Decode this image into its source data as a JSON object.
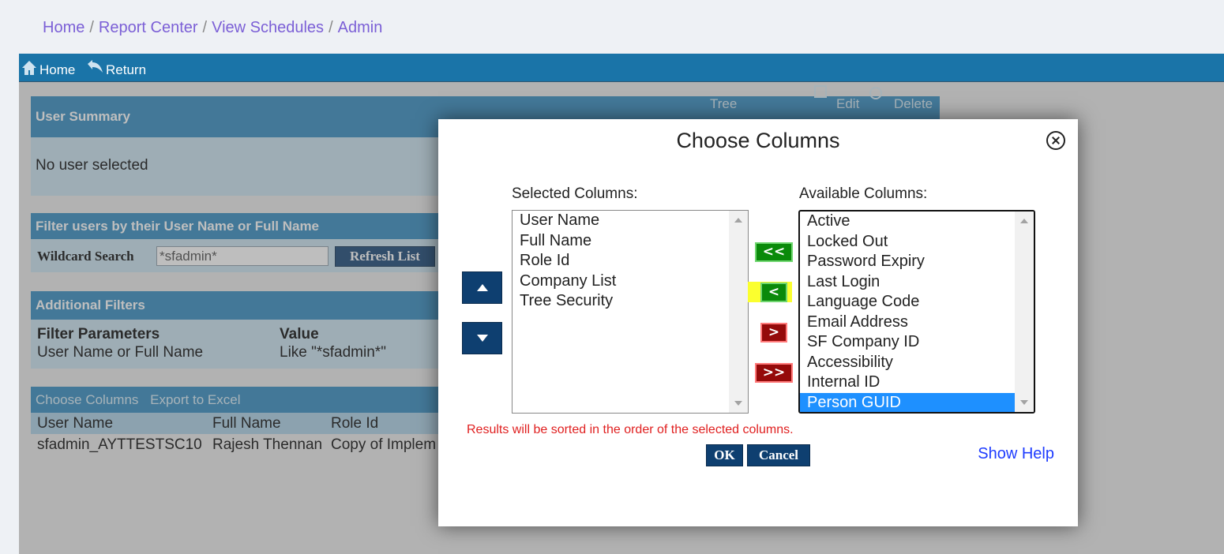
{
  "breadcrumb": {
    "home": "Home",
    "report_center": "Report Center",
    "view_schedules": "View Schedules",
    "admin": "Admin",
    "separator": "/"
  },
  "topbar": {
    "home": "Home",
    "return": "Return"
  },
  "user_summary": {
    "title": "User Summary",
    "tree_label": "Tree",
    "edit_label": "Edit",
    "delete_label": "Delete",
    "status": "No user selected"
  },
  "filter": {
    "title": "Filter users by their User Name or Full Name",
    "wildcard_label": "Wildcard Search",
    "wildcard_value": "*sfadmin*",
    "refresh_button": "Refresh List"
  },
  "additional_filters": {
    "title": "Additional Filters",
    "col_param": "Filter Parameters",
    "col_value": "Value",
    "row_param": "User Name or Full Name",
    "row_value": "Like \"*sfadmin*\""
  },
  "results": {
    "choose_columns_link": "Choose Columns",
    "export_link": "Export to Excel",
    "headers": [
      "User Name",
      "Full Name",
      "Role Id"
    ],
    "row": [
      "sfadmin_AYTTESTSC10",
      "Rajesh Thennan",
      "Copy of Implem"
    ]
  },
  "dialog": {
    "title": "Choose Columns",
    "selected_label": "Selected Columns:",
    "available_label": "Available Columns:",
    "selected_columns": [
      "User Name",
      "Full Name",
      "Role Id",
      "Company List",
      "Tree Security"
    ],
    "available_columns": [
      "Active",
      "Locked Out",
      "Password Expiry",
      "Last Login",
      "Language Code",
      "Email Address",
      "SF Company ID",
      "Accessibility",
      "Internal ID",
      "Person GUID"
    ],
    "selected_available_item": "Person GUID",
    "add_all": "<<",
    "add_one": "<",
    "remove_one": ">",
    "remove_all": ">>",
    "note": "Results will be sorted in the order of the selected columns.",
    "ok": "OK",
    "cancel": "Cancel",
    "help": "Show Help"
  }
}
